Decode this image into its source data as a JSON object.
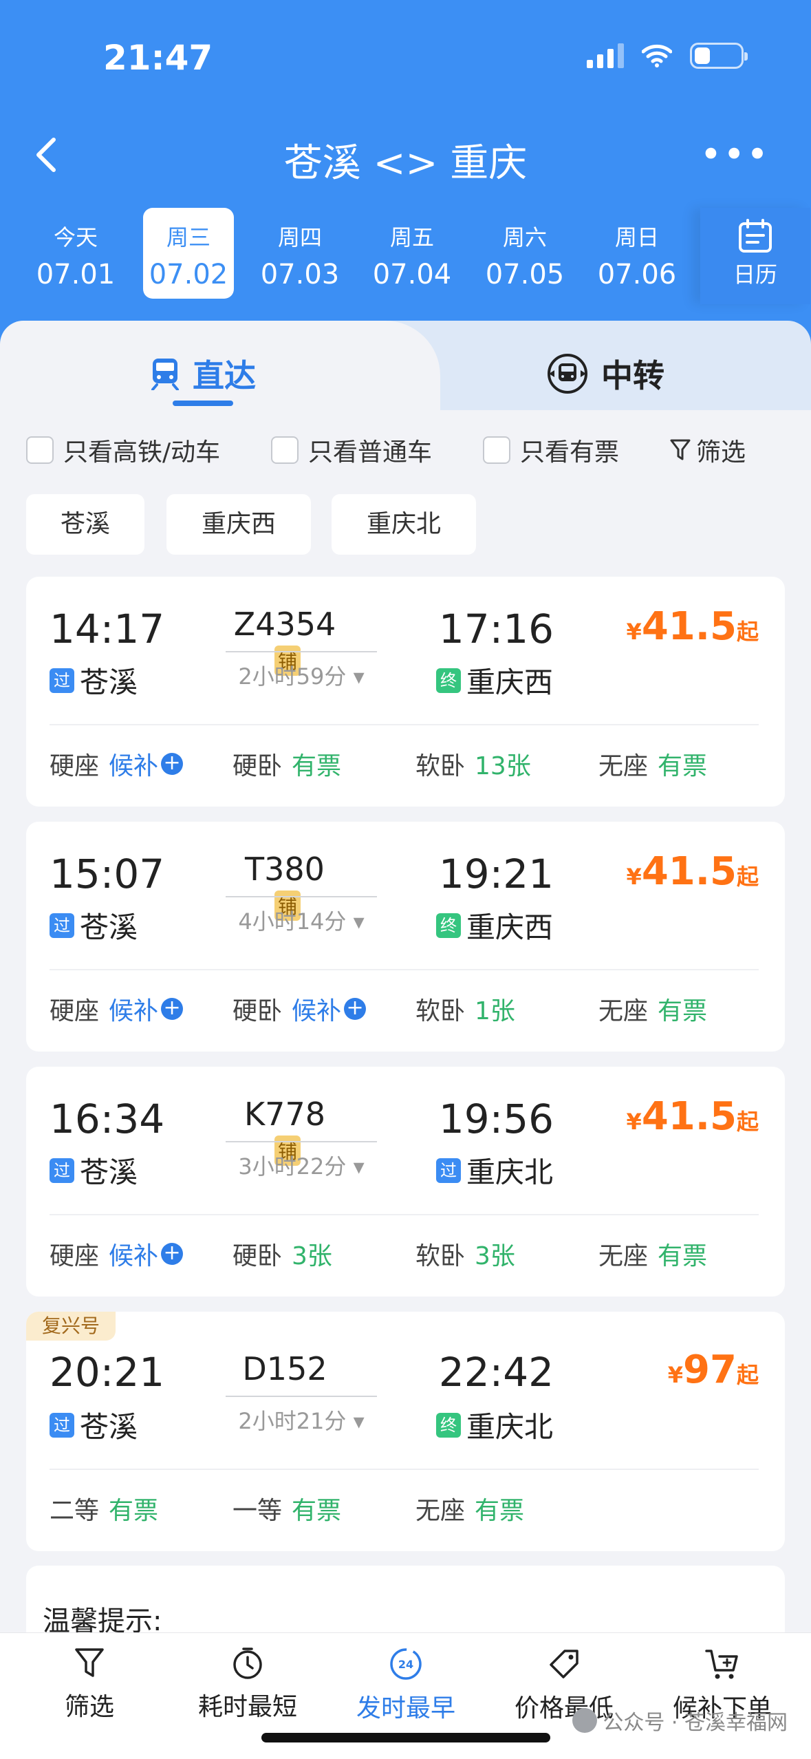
{
  "status_bar": {
    "time": "21:47"
  },
  "header": {
    "title": "苍溪 <> 重庆",
    "more_label": "•••",
    "calendar_label": "日历"
  },
  "dates": [
    {
      "weekday": "今天",
      "date": "07.01",
      "active": false
    },
    {
      "weekday": "周三",
      "date": "07.02",
      "active": true
    },
    {
      "weekday": "周四",
      "date": "07.03",
      "active": false
    },
    {
      "weekday": "周五",
      "date": "07.04",
      "active": false
    },
    {
      "weekday": "周六",
      "date": "07.05",
      "active": false
    },
    {
      "weekday": "周日",
      "date": "07.06",
      "active": false
    }
  ],
  "tabs": {
    "direct": "直达",
    "transfer": "中转"
  },
  "filters": {
    "high_speed": "只看高铁/动车",
    "normal": "只看普通车",
    "available": "只看有票",
    "filter": "筛选"
  },
  "station_chips": [
    "苍溪",
    "重庆西",
    "重庆北"
  ],
  "trains": [
    {
      "dep_time": "14:17",
      "train_no": "Z4354",
      "badge": "铺",
      "arr_time": "17:16",
      "duration": "2小时59分",
      "dep_station": "苍溪",
      "dep_tag": "过",
      "arr_station": "重庆西",
      "arr_tag": "终",
      "price_symbol": "¥",
      "price": "41.5",
      "price_suffix": "起",
      "seats": [
        {
          "name": "硬座",
          "status": "候补",
          "type": "wait"
        },
        {
          "name": "硬卧",
          "status": "有票",
          "type": "avail"
        },
        {
          "name": "软卧",
          "status": "13张",
          "type": "avail"
        },
        {
          "name": "无座",
          "status": "有票",
          "type": "avail"
        }
      ]
    },
    {
      "dep_time": "15:07",
      "train_no": "T380",
      "badge": "铺",
      "arr_time": "19:21",
      "duration": "4小时14分",
      "dep_station": "苍溪",
      "dep_tag": "过",
      "arr_station": "重庆西",
      "arr_tag": "终",
      "price_symbol": "¥",
      "price": "41.5",
      "price_suffix": "起",
      "seats": [
        {
          "name": "硬座",
          "status": "候补",
          "type": "wait"
        },
        {
          "name": "硬卧",
          "status": "候补",
          "type": "wait"
        },
        {
          "name": "软卧",
          "status": "1张",
          "type": "avail"
        },
        {
          "name": "无座",
          "status": "有票",
          "type": "avail"
        }
      ]
    },
    {
      "dep_time": "16:34",
      "train_no": "K778",
      "badge": "铺",
      "arr_time": "19:56",
      "duration": "3小时22分",
      "dep_station": "苍溪",
      "dep_tag": "过",
      "arr_station": "重庆北",
      "arr_tag": "过",
      "price_symbol": "¥",
      "price": "41.5",
      "price_suffix": "起",
      "seats": [
        {
          "name": "硬座",
          "status": "候补",
          "type": "wait"
        },
        {
          "name": "硬卧",
          "status": "3张",
          "type": "avail"
        },
        {
          "name": "软卧",
          "status": "3张",
          "type": "avail"
        },
        {
          "name": "无座",
          "status": "有票",
          "type": "avail"
        }
      ]
    },
    {
      "tag_label": "复兴号",
      "dep_time": "20:21",
      "train_no": "D152",
      "badge": "",
      "arr_time": "22:42",
      "duration": "2小时21分",
      "dep_station": "苍溪",
      "dep_tag": "过",
      "arr_station": "重庆北",
      "arr_tag": "终",
      "price_symbol": "¥",
      "price": "97",
      "price_suffix": "起",
      "seats": [
        {
          "name": "二等",
          "status": "有票",
          "type": "avail"
        },
        {
          "name": "一等",
          "status": "有票",
          "type": "avail"
        },
        {
          "name": "无座",
          "status": "有票",
          "type": "avail"
        }
      ]
    }
  ],
  "tip": {
    "title": "温馨提示:"
  },
  "bottom_bar": [
    {
      "label": "筛选",
      "icon": "filter-icon",
      "active": false
    },
    {
      "label": "耗时最短",
      "icon": "clock-icon",
      "active": false
    },
    {
      "label": "发时最早",
      "icon": "24h-icon",
      "active": true,
      "icon_text": "24"
    },
    {
      "label": "价格最低",
      "icon": "price-tag-icon",
      "active": false
    },
    {
      "label": "候补下单",
      "icon": "cart-plus-icon",
      "active": false
    }
  ],
  "watermark": "公众号 · 苍溪幸福网",
  "colors": {
    "header_blue": "#3c8ff4",
    "accent_blue": "#2e7de8",
    "price_orange": "#ff7214",
    "available_green": "#31b36b",
    "terminal_green": "#35c57f"
  }
}
